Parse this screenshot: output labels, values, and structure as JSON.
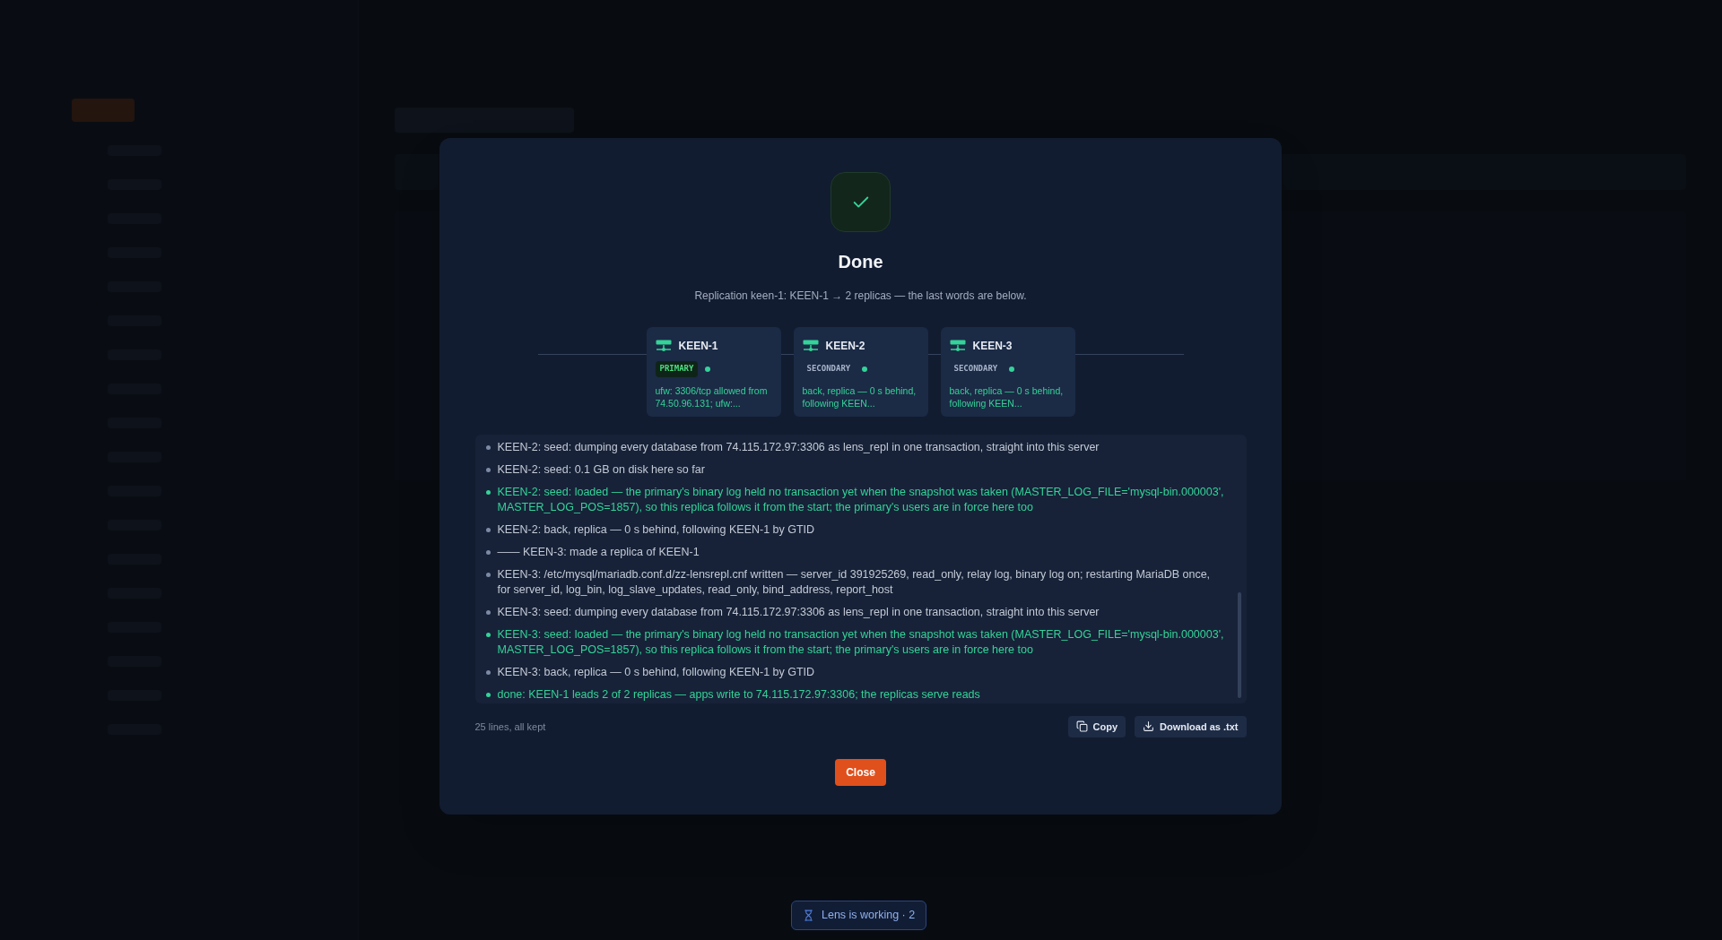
{
  "dialog": {
    "title": "Done",
    "subtitle": "Replication keen-1: KEEN-1 → 2 replicas — the last words are below.",
    "servers": [
      {
        "name": "KEEN-1",
        "role": "PRIMARY",
        "kind": "primary",
        "online": true,
        "note": "ufw: 3306/tcp allowed from 74.50.96.131; ufw:..."
      },
      {
        "name": "KEEN-2",
        "role": "SECONDARY",
        "kind": "secondary",
        "online": true,
        "note": "back, replica — 0 s behind, following KEEN..."
      },
      {
        "name": "KEEN-3",
        "role": "SECONDARY",
        "kind": "secondary",
        "online": true,
        "note": "back, replica — 0 s behind, following KEEN..."
      }
    ],
    "log": [
      {
        "kind": "info",
        "text": "KEEN-2: seed: dumping every database from 74.115.172.97:3306 as lens_repl in one transaction, straight into this server"
      },
      {
        "kind": "info",
        "text": "KEEN-2: seed: 0.1 GB on disk here so far"
      },
      {
        "kind": "success",
        "text": "KEEN-2: seed: loaded — the primary's binary log held no transaction yet when the snapshot was taken (MASTER_LOG_FILE='mysql-bin.000003', MASTER_LOG_POS=1857), so this replica follows it from the start; the primary's users are in force here too"
      },
      {
        "kind": "info",
        "text": "KEEN-2: back, replica — 0 s behind, following KEEN-1 by GTID"
      },
      {
        "kind": "info",
        "text": "—— KEEN-3: made a replica of KEEN-1"
      },
      {
        "kind": "info",
        "text": "KEEN-3: /etc/mysql/mariadb.conf.d/zz-lensrepl.cnf written — server_id 391925269, read_only, relay log, binary log on; restarting MariaDB once, for server_id, log_bin, log_slave_updates, read_only, bind_address, report_host"
      },
      {
        "kind": "info",
        "text": "KEEN-3: seed: dumping every database from 74.115.172.97:3306 as lens_repl in one transaction, straight into this server"
      },
      {
        "kind": "success",
        "text": "KEEN-3: seed: loaded — the primary's binary log held no transaction yet when the snapshot was taken (MASTER_LOG_FILE='mysql-bin.000003', MASTER_LOG_POS=1857), so this replica follows it from the start; the primary's users are in force here too"
      },
      {
        "kind": "info",
        "text": "KEEN-3: back, replica — 0 s behind, following KEEN-1 by GTID"
      },
      {
        "kind": "success",
        "text": "done: KEEN-1 leads 2 of 2 replicas — apps write to 74.115.172.97:3306; the replicas serve reads"
      }
    ],
    "line_count": "25 lines, all kept",
    "buttons": {
      "copy": "Copy",
      "download": "Download as .txt",
      "close": "Close"
    }
  },
  "activity": {
    "label": "Lens is working · 2"
  }
}
